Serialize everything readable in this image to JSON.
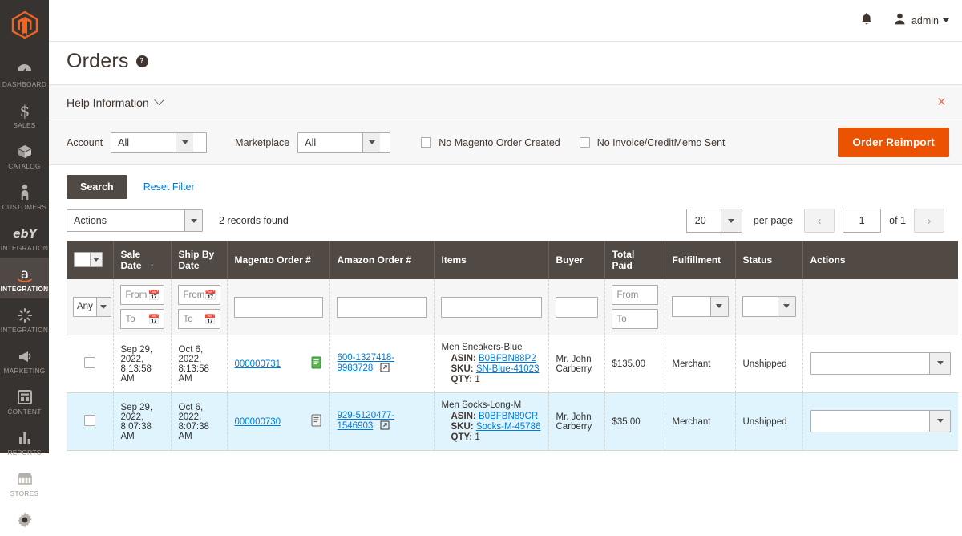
{
  "sidebar": {
    "logo_name": "magento-logo",
    "items": [
      {
        "label": "DASHBOARD",
        "icon": "dashboard-icon",
        "active": false
      },
      {
        "label": "SALES",
        "icon": "dollar-icon",
        "active": false
      },
      {
        "label": "CATALOG",
        "icon": "box-icon",
        "active": false
      },
      {
        "label": "CUSTOMERS",
        "icon": "person-icon",
        "active": false
      },
      {
        "label": "INTEGRATION",
        "icon": "ebay-icon",
        "active": false
      },
      {
        "label": "INTEGRATION",
        "icon": "amazon-icon",
        "active": true
      },
      {
        "label": "INTEGRATION",
        "icon": "burst-icon",
        "active": false
      },
      {
        "label": "MARKETING",
        "icon": "megaphone-icon",
        "active": false
      },
      {
        "label": "CONTENT",
        "icon": "layout-icon",
        "active": false
      },
      {
        "label": "REPORTS",
        "icon": "bar-chart-icon",
        "active": false
      },
      {
        "label": "STORES",
        "icon": "storefront-icon",
        "active": false
      },
      {
        "label": "",
        "icon": "gear-icon",
        "active": false
      }
    ]
  },
  "topbar": {
    "bell_icon": "notification-bell-icon",
    "user_icon": "user-avatar-icon",
    "username": "admin"
  },
  "header": {
    "title": "Orders",
    "help_badge": "?"
  },
  "help_bar": {
    "label": "Help Information",
    "chevron_icon": "chevron-down-icon",
    "close_icon": "close-icon",
    "close_glyph": "×"
  },
  "filters": {
    "account_label": "Account",
    "account_value": "All",
    "marketplace_label": "Marketplace",
    "marketplace_value": "All",
    "checkbox_no_magento": "No Magento Order Created",
    "checkbox_no_invoice": "No Invoice/CreditMemo Sent",
    "reimport_button": "Order Reimport"
  },
  "actions_bar": {
    "search_button": "Search",
    "reset_filter": "Reset Filter",
    "actions_select": "Actions",
    "records_found": "2 records found"
  },
  "pager": {
    "per_page_value": "20",
    "per_page_label": "per page",
    "prev_icon": "chevron-left-icon",
    "next_icon": "chevron-right-icon",
    "page_value": "1",
    "of_label": "of 1"
  },
  "grid": {
    "columns": [
      {
        "label": "",
        "key": "checkbox"
      },
      {
        "label": "Sale Date",
        "key": "sale_date",
        "sorted": true,
        "sort_glyph": "↑"
      },
      {
        "label": "Ship By Date",
        "key": "ship_by_date"
      },
      {
        "label": "Magento Order #",
        "key": "magento_order"
      },
      {
        "label": "Amazon Order #",
        "key": "amazon_order"
      },
      {
        "label": "Items",
        "key": "items"
      },
      {
        "label": "Buyer",
        "key": "buyer"
      },
      {
        "label": "Total Paid",
        "key": "total_paid"
      },
      {
        "label": "Fulfillment",
        "key": "fulfillment"
      },
      {
        "label": "Status",
        "key": "status"
      },
      {
        "label": "Actions",
        "key": "actions"
      }
    ],
    "filter_row": {
      "select_any": "Any",
      "from_placeholder": "From",
      "to_placeholder": "To",
      "magento_order_value": "",
      "amazon_order_value": "",
      "items_value": "",
      "buyer_value": "",
      "total_from": "From",
      "total_to": "To",
      "fulfillment_value": "",
      "status_value": ""
    },
    "rows": [
      {
        "highlighted": false,
        "sale_date": "Sep 29, 2022, 8:13:58 AM",
        "ship_by_date": "Oct 6, 2022, 8:13:58 AM",
        "magento_order": "000000731",
        "magento_doc_icon": "invoice-document-icon",
        "amazon_order": "600-1327418-9983728",
        "amazon_ext_icon": "external-link-icon",
        "item_title": "Men Sneakers-Blue",
        "item_asin_label": "ASIN:",
        "item_asin": "B0BFBN88P2",
        "item_sku_label": "SKU:",
        "item_sku": "SN-Blue-41023",
        "item_qty_label": "QTY:",
        "item_qty": "1",
        "buyer": "Mr. John Carberry",
        "total_paid": "$135.00",
        "fulfillment": "Merchant",
        "status": "Unshipped",
        "action_value": ""
      },
      {
        "highlighted": true,
        "sale_date": "Sep 29, 2022, 8:07:38 AM",
        "ship_by_date": "Oct 6, 2022, 8:07:38 AM",
        "magento_order": "000000730",
        "magento_doc_icon": "invoice-document-icon",
        "amazon_order": "929-5120477-1546903",
        "amazon_ext_icon": "external-link-icon",
        "item_title": "Men Socks-Long-M",
        "item_asin_label": "ASIN:",
        "item_asin": "B0BFBN89CR",
        "item_sku_label": "SKU:",
        "item_sku": "Socks-M-45786",
        "item_qty_label": "QTY:",
        "item_qty": "1",
        "buyer": "Mr. John Carberry",
        "total_paid": "$35.00",
        "fulfillment": "Merchant",
        "status": "Unshipped",
        "action_value": ""
      }
    ]
  },
  "colors": {
    "accent_orange": "#eb5202",
    "sidebar_bg": "#373330",
    "header_row_bg": "#514943",
    "link_blue": "#007bdb",
    "row_highlight": "#e0f4fd"
  }
}
